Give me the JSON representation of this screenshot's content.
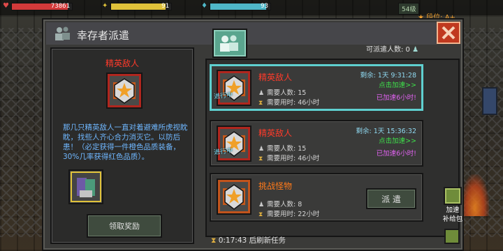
{
  "hud": {
    "health_value": "73861",
    "energy_value": "91",
    "water_value": "93",
    "health_fill": 0.93,
    "energy_fill": 0.91,
    "water_fill": 0.93,
    "health_color": "#d23a3a",
    "energy_color": "#e0c23a",
    "water_color": "#4fb7c8",
    "level": "54级",
    "rank": "段位: A+"
  },
  "dialog": {
    "title": "幸存者派遣",
    "close_icon": "close-x-icon"
  },
  "left_panel": {
    "enemy_name": "精英敌人",
    "description": "那几只精英敌人一直对着避难所虎视眈眈，找些人齐心合力消灭它。以防后患！（必定获得一件橙色品质装备，30%几率获得红色品质）。",
    "reward_button": "领取奖励"
  },
  "dispatch": {
    "available_label": "可派遣人数: 0"
  },
  "missions": [
    {
      "name": "精英敌人",
      "name_color": "#ff3a2a",
      "people": "需要人数: 15",
      "time": "需要用时: 46小时",
      "remaining": "剩余: 1天 9:31:28",
      "speedup": "点击加速>>",
      "boosted": "已加速6小时!",
      "stamp": "进行中",
      "selected": true
    },
    {
      "name": "精英敌人",
      "name_color": "#ff3a2a",
      "people": "需要人数: 15",
      "time": "需要用时: 46小时",
      "remaining": "剩余: 1天 15:36:32",
      "speedup": "点击加速>>",
      "boosted": "已加速6小时!",
      "stamp": "进行中",
      "selected": false
    },
    {
      "name": "挑战怪物",
      "name_color": "#ff7a1a",
      "people": "需要人数: 8",
      "time": "需要用时: 22小时",
      "dispatch_button": "派 遣",
      "selected": false
    }
  ],
  "refresh_text": "0:17:43 后刷新任务",
  "supply": {
    "label_line1": "加速",
    "label_line2": "补给包"
  }
}
